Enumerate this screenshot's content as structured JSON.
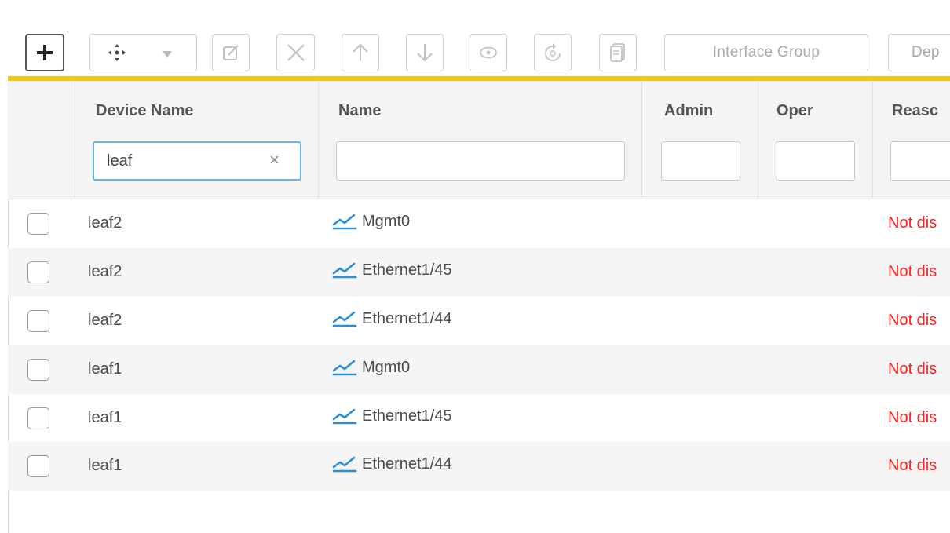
{
  "toolbar": {
    "interface_group_label": "Interface Group",
    "deploy_label": "Dep"
  },
  "table": {
    "headers": {
      "device_name": "Device Name",
      "name": "Name",
      "admin": "Admin",
      "oper": "Oper",
      "reason": "Reasc"
    },
    "filters": {
      "device_name": "leaf",
      "name": "",
      "admin": "",
      "oper": "",
      "reason": ""
    },
    "rows": [
      {
        "device": "leaf2",
        "name": "Mgmt0",
        "reason": "Not dis"
      },
      {
        "device": "leaf2",
        "name": "Ethernet1/45",
        "reason": "Not dis"
      },
      {
        "device": "leaf2",
        "name": "Ethernet1/44",
        "reason": "Not dis"
      },
      {
        "device": "leaf1",
        "name": "Mgmt0",
        "reason": "Not dis"
      },
      {
        "device": "leaf1",
        "name": "Ethernet1/45",
        "reason": "Not dis"
      },
      {
        "device": "leaf1",
        "name": "Ethernet1/44",
        "reason": "Not dis"
      }
    ]
  },
  "colors": {
    "accent_bar": "#f3c514",
    "reason_text": "#ff1f1f",
    "chart_icon": "#2a8fd6",
    "active_filter_border": "#6ab4e0"
  },
  "icons": [
    "plus-icon",
    "move-icon",
    "dropdown-caret-icon",
    "edit-icon",
    "delete-icon",
    "move-up-icon",
    "move-down-icon",
    "preview-icon",
    "rediscover-icon",
    "copy-icon",
    "clear-icon",
    "chart-line-icon"
  ]
}
